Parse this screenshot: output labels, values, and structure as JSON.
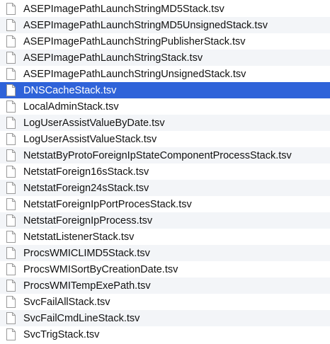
{
  "file_list": {
    "icon": "document-icon",
    "selected_index": 5,
    "colors": {
      "selection": "#2f63d9",
      "stripe": "#f3f5f8",
      "text": "#111111",
      "selected_text": "#ffffff"
    },
    "files": [
      "ASEPImagePathLaunchStringMD5Stack.tsv",
      "ASEPImagePathLaunchStringMD5UnsignedStack.tsv",
      "ASEPImagePathLaunchStringPublisherStack.tsv",
      "ASEPImagePathLaunchStringStack.tsv",
      "ASEPImagePathLaunchStringUnsignedStack.tsv",
      "DNSCacheStack.tsv",
      "LocalAdminStack.tsv",
      "LogUserAssistValueByDate.tsv",
      "LogUserAssistValueStack.tsv",
      "NetstatByProtoForeignIpStateComponentProcessStack.tsv",
      "NetstatForeign16sStack.tsv",
      "NetstatForeign24sStack.tsv",
      "NetstatForeignIpPortProcesStack.tsv",
      "NetstatForeignIpProcess.tsv",
      "NetstatListenerStack.tsv",
      "ProcsWMICLIMD5Stack.tsv",
      "ProcsWMISortByCreationDate.tsv",
      "ProcsWMITempExePath.tsv",
      "SvcFailAllStack.tsv",
      "SvcFailCmdLineStack.tsv",
      "SvcTrigStack.tsv"
    ]
  }
}
